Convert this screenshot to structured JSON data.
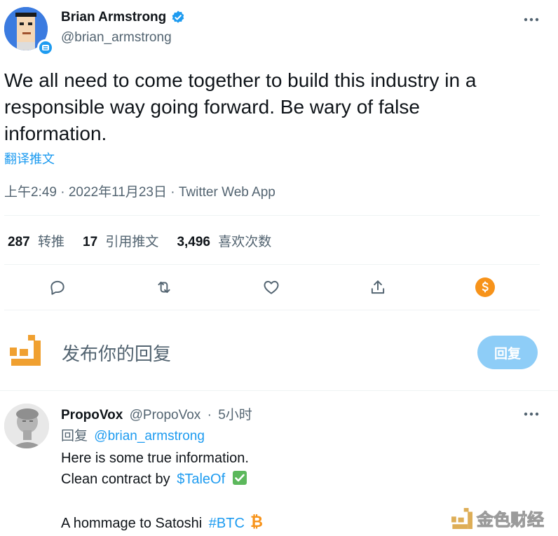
{
  "tweet": {
    "author_name": "Brian Armstrong",
    "author_handle": "@brian_armstrong",
    "text_lines": [
      "We all need to come together to build this industry in a",
      "responsible way going forward. Be wary of false",
      "information."
    ],
    "translate_label": "翻译推文",
    "meta": "上午2:49 · 2022年11月23日 · Twitter Web App"
  },
  "stats": {
    "retweets_count": "287",
    "retweets_label": "转推",
    "quotes_count": "17",
    "quotes_label": "引用推文",
    "likes_count": "3,496",
    "likes_label": "喜欢次数"
  },
  "actions": [
    "reply-icon",
    "retweet-icon",
    "like-icon",
    "share-icon",
    "tip-icon"
  ],
  "composer": {
    "placeholder": "发布你的回复",
    "reply_button": "回复"
  },
  "reply": {
    "author_name": "PropoVox",
    "author_handle": "@PropoVox",
    "separator": "·",
    "time": "5小时",
    "replying_prefix": "回复",
    "replying_to": "@brian_armstrong",
    "line1": "Here is some true information.",
    "line2_prefix": "Clean contract by",
    "line2_link": "$TaleOf",
    "line3_prefix": "A hommage to Satoshi",
    "line3_link": "#BTC"
  },
  "watermark": "金色财经",
  "colors": {
    "accent": "#1d9bf0",
    "reply_button_bg": "#8ecdf7",
    "tip_orange": "#f7931a",
    "composer_logo_orange": "#f0a030"
  }
}
